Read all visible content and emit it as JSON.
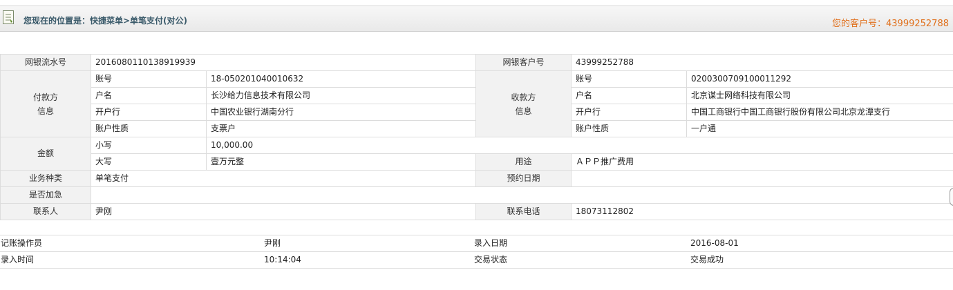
{
  "header": {
    "location": "您现在的位置是：快捷菜单>单笔支付(对公)",
    "customer": "您的客户号：43999252788"
  },
  "form": {
    "serial_label": "网银流水号",
    "serial_value": "2016080110138919939",
    "client_label": "网银客户号",
    "client_value": "43999252788",
    "payer_label": "付款方\n信息",
    "payee_label": "收款方\n信息",
    "payer": {
      "account_label": "账号",
      "account": "18-050201040010632",
      "name_label": "户名",
      "name": "长沙给力信息技术有限公司",
      "bank_label": "开户行",
      "bank": "中国农业银行湖南分行",
      "type_label": "账户性质",
      "type": "支票户"
    },
    "payee": {
      "account_label": "账号",
      "account": "0200300709100011292",
      "name_label": "户名",
      "name": "北京谋士网络科技有限公司",
      "bank_label": "开户行",
      "bank": "中国工商银行中国工商银行股份有限公司北京龙潭支行",
      "type_label": "账户性质",
      "type": "一户通"
    },
    "amount_label": "金额",
    "small_label": "小写",
    "small_value": "10,000.00",
    "big_label": "大写",
    "big_value": "壹万元整",
    "purpose_label": "用途",
    "purpose_value": "ＡＰＰ推广费用",
    "biz_label": "业务种类",
    "biz_value": "单笔支付",
    "appoint_label": "预约日期",
    "appoint_value": "",
    "urgent_label": "是否加急",
    "urgent_value": "",
    "contact_label": "联系人",
    "contact_value": "尹刚",
    "phone_label": "联系电话",
    "phone_value": "18073112802"
  },
  "record": {
    "operator_label": "记账操作员",
    "operator_value": "尹刚",
    "date_label": "录入日期",
    "date_value": "2016-08-01",
    "time_label": "录入时间",
    "time_value": "10:14:04",
    "status_label": "交易状态",
    "status_value": "交易成功"
  }
}
